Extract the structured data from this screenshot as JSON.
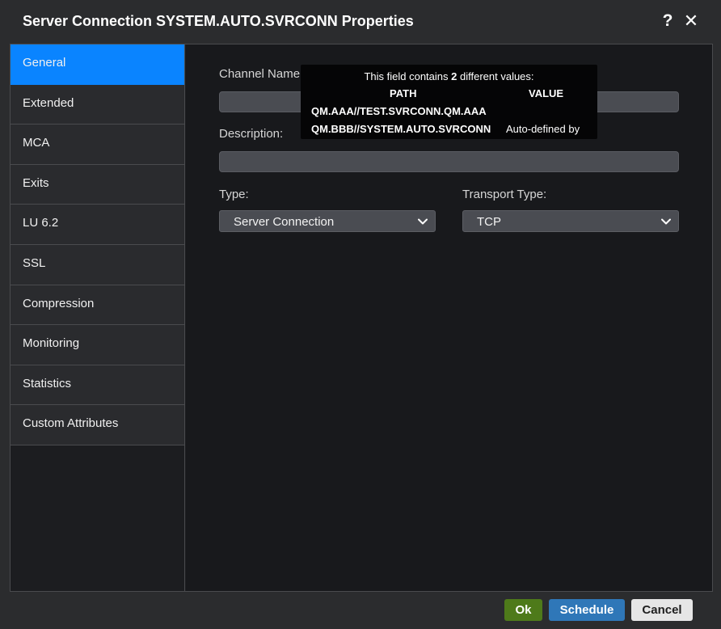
{
  "dialog": {
    "title": "Server Connection SYSTEM.AUTO.SVRCONN Properties",
    "help_glyph": "?",
    "close_glyph": "✕"
  },
  "sidebar": {
    "items": [
      {
        "label": "General",
        "active": true
      },
      {
        "label": "Extended"
      },
      {
        "label": "MCA"
      },
      {
        "label": "Exits"
      },
      {
        "label": "LU 6.2"
      },
      {
        "label": "SSL"
      },
      {
        "label": "Compression"
      },
      {
        "label": "Monitoring"
      },
      {
        "label": "Statistics"
      },
      {
        "label": "Custom Attributes"
      }
    ]
  },
  "form": {
    "channel_name_label": "Channel Name:",
    "channel_name_value": "",
    "description_label": "Description:",
    "description_value": "",
    "type_label": "Type:",
    "type_value": "Server Connection",
    "transport_label": "Transport Type:",
    "transport_value": "TCP"
  },
  "tooltip": {
    "prefix": "This field contains ",
    "count": "2",
    "suffix": " different values:",
    "col_path": "PATH",
    "col_value": "VALUE",
    "rows": [
      {
        "path": "QM.AAA//TEST.SVRCONN.QM.AAA",
        "value": ""
      },
      {
        "path": "QM.BBB//SYSTEM.AUTO.SVRCONN",
        "value": "Auto-defined by"
      }
    ]
  },
  "footer": {
    "ok": "Ok",
    "schedule": "Schedule",
    "cancel": "Cancel"
  },
  "colors": {
    "accent": "#0a84ff",
    "ok": "#4e7a1a",
    "schedule": "#2f77b8"
  }
}
